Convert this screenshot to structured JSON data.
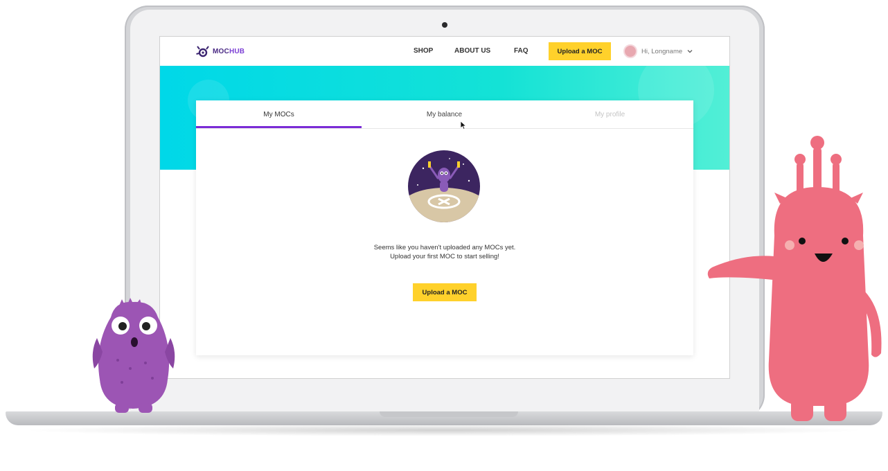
{
  "navbar": {
    "logo_text_a": "MOC",
    "logo_text_b": "HUB",
    "links": [
      "SHOP",
      "ABOUT US",
      "FAQ"
    ],
    "upload_label": "Upload a MOC",
    "user_greeting": "Hi, Longname"
  },
  "tabs": [
    {
      "label": "My MOCs",
      "state": "active"
    },
    {
      "label": "My balance",
      "state": "default"
    },
    {
      "label": "My profile",
      "state": "disabled"
    }
  ],
  "empty_state": {
    "line1": "Seems like you haven't uploaded any MOCs yet.",
    "line2": "Upload your first MOC to start selling!",
    "button_label": "Upload a MOC"
  },
  "colors": {
    "accent_yellow": "#ffd12b",
    "tab_active": "#7a2cd6",
    "hero_start": "#00d8e8",
    "hero_end": "#52efd6"
  },
  "icons": [
    "mochub-logo-icon",
    "user-avatar",
    "chevron-down-icon",
    "mouse-cursor-icon",
    "empty-state-illustration"
  ]
}
